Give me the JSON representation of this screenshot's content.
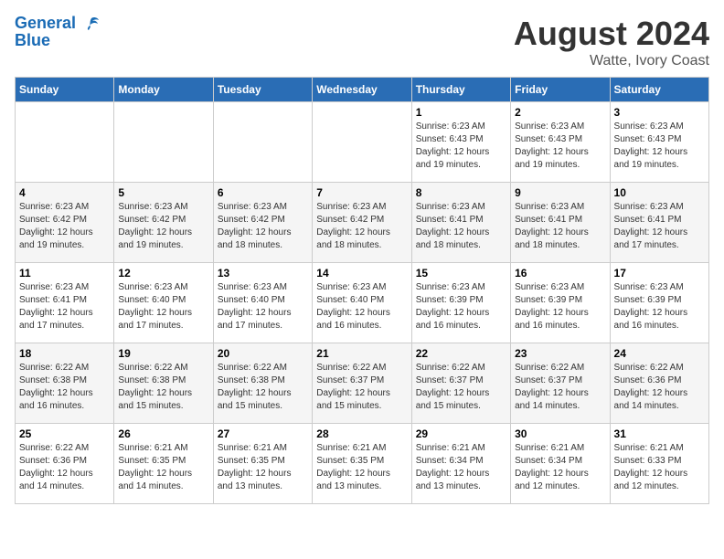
{
  "logo": {
    "line1": "General",
    "line2": "Blue"
  },
  "title": "August 2024",
  "subtitle": "Watte, Ivory Coast",
  "days_of_week": [
    "Sunday",
    "Monday",
    "Tuesday",
    "Wednesday",
    "Thursday",
    "Friday",
    "Saturday"
  ],
  "weeks": [
    [
      {
        "day": "",
        "info": ""
      },
      {
        "day": "",
        "info": ""
      },
      {
        "day": "",
        "info": ""
      },
      {
        "day": "",
        "info": ""
      },
      {
        "day": "1",
        "info": "Sunrise: 6:23 AM\nSunset: 6:43 PM\nDaylight: 12 hours\nand 19 minutes."
      },
      {
        "day": "2",
        "info": "Sunrise: 6:23 AM\nSunset: 6:43 PM\nDaylight: 12 hours\nand 19 minutes."
      },
      {
        "day": "3",
        "info": "Sunrise: 6:23 AM\nSunset: 6:43 PM\nDaylight: 12 hours\nand 19 minutes."
      }
    ],
    [
      {
        "day": "4",
        "info": "Sunrise: 6:23 AM\nSunset: 6:42 PM\nDaylight: 12 hours\nand 19 minutes."
      },
      {
        "day": "5",
        "info": "Sunrise: 6:23 AM\nSunset: 6:42 PM\nDaylight: 12 hours\nand 19 minutes."
      },
      {
        "day": "6",
        "info": "Sunrise: 6:23 AM\nSunset: 6:42 PM\nDaylight: 12 hours\nand 18 minutes."
      },
      {
        "day": "7",
        "info": "Sunrise: 6:23 AM\nSunset: 6:42 PM\nDaylight: 12 hours\nand 18 minutes."
      },
      {
        "day": "8",
        "info": "Sunrise: 6:23 AM\nSunset: 6:41 PM\nDaylight: 12 hours\nand 18 minutes."
      },
      {
        "day": "9",
        "info": "Sunrise: 6:23 AM\nSunset: 6:41 PM\nDaylight: 12 hours\nand 18 minutes."
      },
      {
        "day": "10",
        "info": "Sunrise: 6:23 AM\nSunset: 6:41 PM\nDaylight: 12 hours\nand 17 minutes."
      }
    ],
    [
      {
        "day": "11",
        "info": "Sunrise: 6:23 AM\nSunset: 6:41 PM\nDaylight: 12 hours\nand 17 minutes."
      },
      {
        "day": "12",
        "info": "Sunrise: 6:23 AM\nSunset: 6:40 PM\nDaylight: 12 hours\nand 17 minutes."
      },
      {
        "day": "13",
        "info": "Sunrise: 6:23 AM\nSunset: 6:40 PM\nDaylight: 12 hours\nand 17 minutes."
      },
      {
        "day": "14",
        "info": "Sunrise: 6:23 AM\nSunset: 6:40 PM\nDaylight: 12 hours\nand 16 minutes."
      },
      {
        "day": "15",
        "info": "Sunrise: 6:23 AM\nSunset: 6:39 PM\nDaylight: 12 hours\nand 16 minutes."
      },
      {
        "day": "16",
        "info": "Sunrise: 6:23 AM\nSunset: 6:39 PM\nDaylight: 12 hours\nand 16 minutes."
      },
      {
        "day": "17",
        "info": "Sunrise: 6:23 AM\nSunset: 6:39 PM\nDaylight: 12 hours\nand 16 minutes."
      }
    ],
    [
      {
        "day": "18",
        "info": "Sunrise: 6:22 AM\nSunset: 6:38 PM\nDaylight: 12 hours\nand 16 minutes."
      },
      {
        "day": "19",
        "info": "Sunrise: 6:22 AM\nSunset: 6:38 PM\nDaylight: 12 hours\nand 15 minutes."
      },
      {
        "day": "20",
        "info": "Sunrise: 6:22 AM\nSunset: 6:38 PM\nDaylight: 12 hours\nand 15 minutes."
      },
      {
        "day": "21",
        "info": "Sunrise: 6:22 AM\nSunset: 6:37 PM\nDaylight: 12 hours\nand 15 minutes."
      },
      {
        "day": "22",
        "info": "Sunrise: 6:22 AM\nSunset: 6:37 PM\nDaylight: 12 hours\nand 15 minutes."
      },
      {
        "day": "23",
        "info": "Sunrise: 6:22 AM\nSunset: 6:37 PM\nDaylight: 12 hours\nand 14 minutes."
      },
      {
        "day": "24",
        "info": "Sunrise: 6:22 AM\nSunset: 6:36 PM\nDaylight: 12 hours\nand 14 minutes."
      }
    ],
    [
      {
        "day": "25",
        "info": "Sunrise: 6:22 AM\nSunset: 6:36 PM\nDaylight: 12 hours\nand 14 minutes."
      },
      {
        "day": "26",
        "info": "Sunrise: 6:21 AM\nSunset: 6:35 PM\nDaylight: 12 hours\nand 14 minutes."
      },
      {
        "day": "27",
        "info": "Sunrise: 6:21 AM\nSunset: 6:35 PM\nDaylight: 12 hours\nand 13 minutes."
      },
      {
        "day": "28",
        "info": "Sunrise: 6:21 AM\nSunset: 6:35 PM\nDaylight: 12 hours\nand 13 minutes."
      },
      {
        "day": "29",
        "info": "Sunrise: 6:21 AM\nSunset: 6:34 PM\nDaylight: 12 hours\nand 13 minutes."
      },
      {
        "day": "30",
        "info": "Sunrise: 6:21 AM\nSunset: 6:34 PM\nDaylight: 12 hours\nand 12 minutes."
      },
      {
        "day": "31",
        "info": "Sunrise: 6:21 AM\nSunset: 6:33 PM\nDaylight: 12 hours\nand 12 minutes."
      }
    ]
  ]
}
